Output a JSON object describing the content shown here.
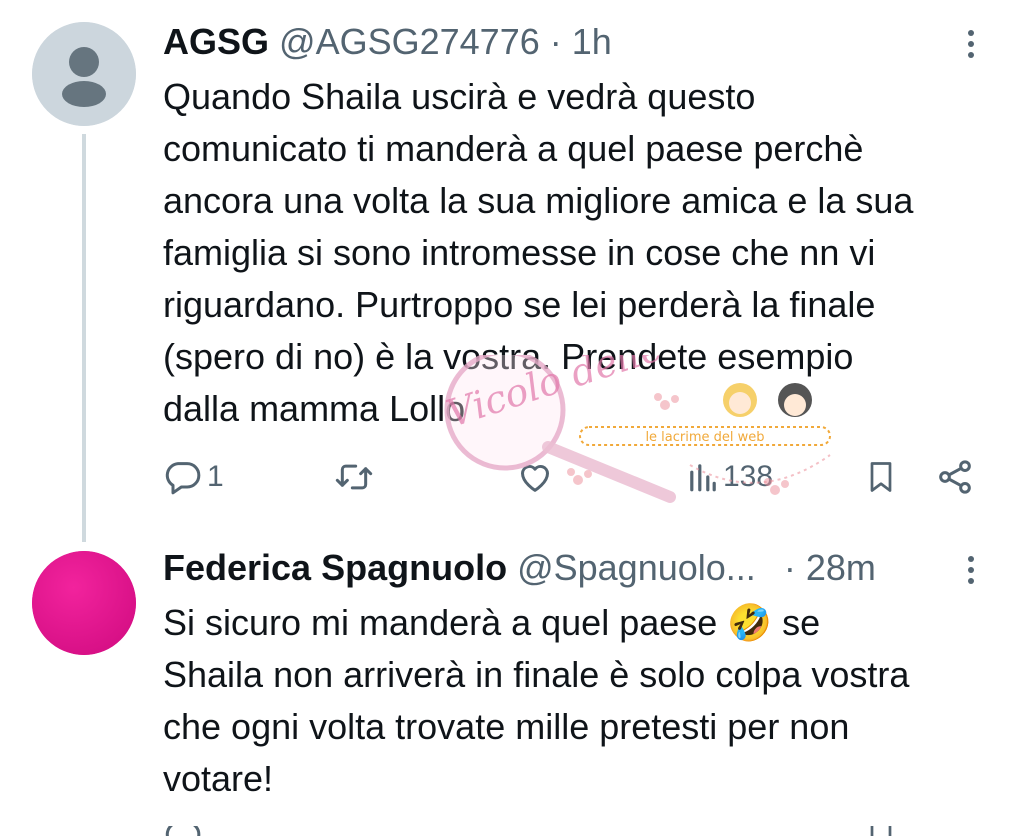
{
  "tweets": [
    {
      "display_name": "AGSG",
      "handle": "@AGSG274776",
      "separator": "·",
      "time": "1h",
      "text_lines": [
        "Quando Shaila uscirà e vedrà questo",
        "comunicato ti manderà a quel paese perchè",
        "ancora una volta la sua migliore amica e la sua",
        "famiglia si sono intromesse in cose che nn vi",
        "riguardano. Purtroppo se lei perderà la finale",
        "(spero di no) è la vostra. Prendete esempio",
        "dalla mamma Lollo"
      ],
      "reply_count": "1",
      "retweet_count": "",
      "like_count": "",
      "view_count": "138",
      "avatar_color": "#ccd6dd"
    },
    {
      "display_name": "Federica Spagnuolo",
      "handle": "@Spagnuolo...",
      "separator": "·",
      "time": "28m",
      "text_lines": [
        "Si sicuro mi manderà a quel paese 🤣 se",
        "Shaila non arriverà in finale è solo colpa vostra",
        "che ogni volta trovate mille pretesti per non",
        "votare!"
      ],
      "avatar_color": "#e0148f"
    }
  ],
  "watermark": {
    "script_text": "Vicolo delle News",
    "site_text": "le lacrime del web"
  },
  "icons": {
    "reply": "reply-icon",
    "retweet": "retweet-icon",
    "like": "heart-icon",
    "views": "views-icon",
    "bookmark": "bookmark-icon",
    "share": "share-icon",
    "more": "more-icon"
  },
  "colors": {
    "text": "#0f1419",
    "secondary": "#536471",
    "thread_line": "#cfd9de"
  }
}
